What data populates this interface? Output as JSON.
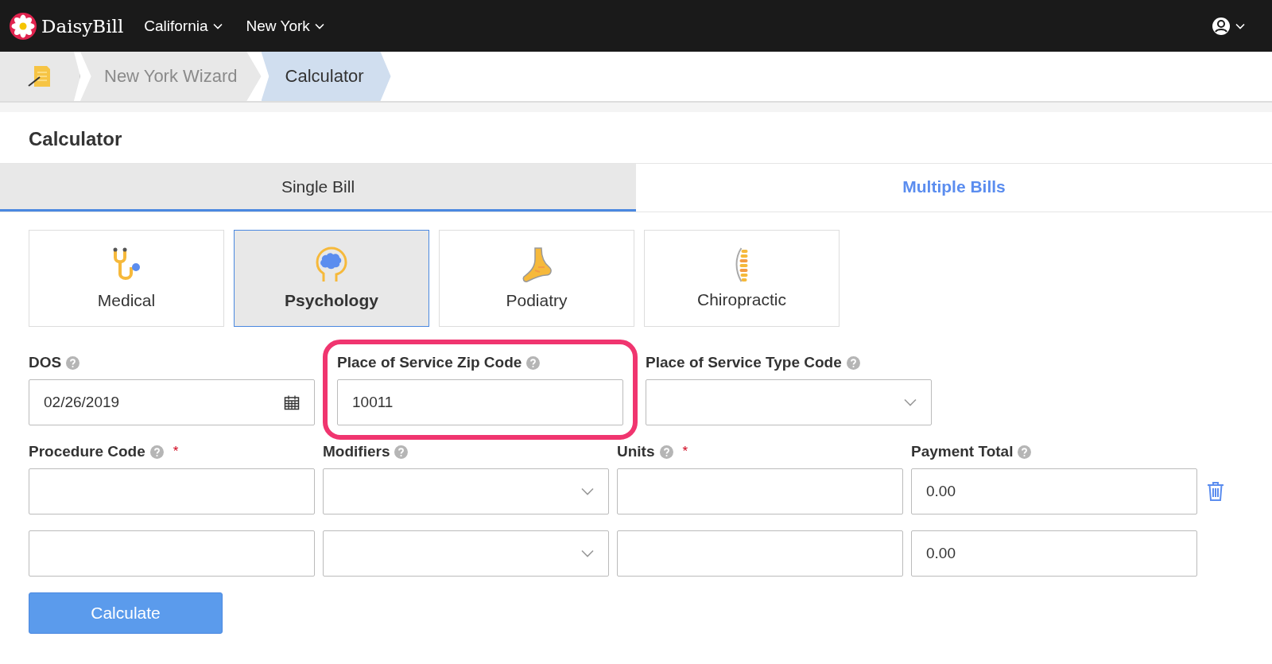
{
  "nav": {
    "brand": "DaisyBill",
    "menus": [
      "California",
      "New York"
    ]
  },
  "breadcrumb": [
    {
      "label": "New York Wizard",
      "selected": false
    },
    {
      "label": "Calculator",
      "selected": true
    }
  ],
  "heading": "Calculator",
  "tabs": [
    {
      "label": "Single Bill",
      "selected": true
    },
    {
      "label": "Multiple Bills",
      "selected": false
    }
  ],
  "categories": [
    {
      "label": "Medical",
      "kind": "stethoscope",
      "selected": false
    },
    {
      "label": "Psychology",
      "kind": "brain",
      "selected": true
    },
    {
      "label": "Podiatry",
      "kind": "foot",
      "selected": false
    },
    {
      "label": "Chiropractic",
      "kind": "spine",
      "selected": false
    }
  ],
  "fields": [
    {
      "label": "DOS",
      "kind": "date",
      "value": "02/26/2019",
      "highlighted": false
    },
    {
      "label": "Place of Service Zip Code",
      "kind": "text",
      "value": "10011",
      "highlighted": true
    },
    {
      "label": "Place of Service Type Code",
      "kind": "select",
      "highlighted": false
    }
  ],
  "line_items": {
    "columns": [
      {
        "label": "Procedure Code",
        "marker": "*"
      },
      {
        "label": "Modifiers"
      },
      {
        "label": "Units",
        "marker": "*"
      },
      {
        "label": "Payment Total"
      }
    ],
    "rows": [
      {
        "payment_total": "0.00",
        "deletable": true
      },
      {
        "payment_total": "0.00",
        "deletable": false
      }
    ]
  },
  "button": "Calculate"
}
